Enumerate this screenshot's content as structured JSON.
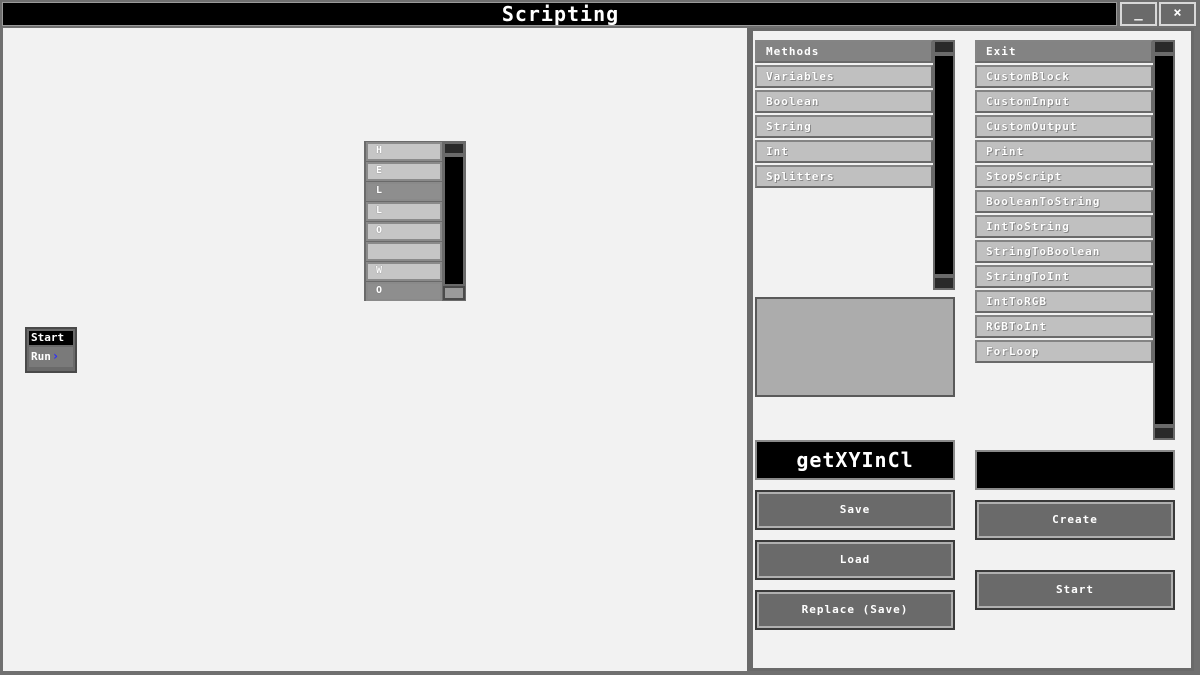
{
  "window": {
    "title": "Scripting",
    "minimize_label": "_",
    "close_label": "×"
  },
  "canvas": {
    "word_stack": [
      "H",
      "E",
      "L",
      "L",
      "O",
      "",
      "W",
      "O"
    ],
    "start_block": {
      "header": "Start",
      "run_label": "Run",
      "arrow": "›"
    }
  },
  "categories": {
    "items": [
      "Methods",
      "Variables",
      "Boolean",
      "String",
      "Int",
      "Splitters"
    ],
    "selected": "Methods"
  },
  "methods": {
    "items": [
      "Exit",
      "CustomBlock",
      "CustomInput",
      "CustomOutput",
      "Print",
      "StopScript",
      "BooleanToString",
      "IntToString",
      "StringToBoolean",
      "StringToInt",
      "IntToRGB",
      "RGBToInt",
      "ForLoop"
    ],
    "selected": "Exit"
  },
  "script_name": {
    "value": "getXYInCl"
  },
  "buttons": {
    "save": "Save",
    "load": "Load",
    "replace": "Replace (Save)",
    "create": "Create",
    "start": "Start"
  },
  "colors": {
    "panel_bg": "#f2f2f2",
    "frame": "#6a6a6a",
    "list_item": "#c0c0c0",
    "list_selected": "#838383",
    "run_arrow": "#2a2aff"
  }
}
